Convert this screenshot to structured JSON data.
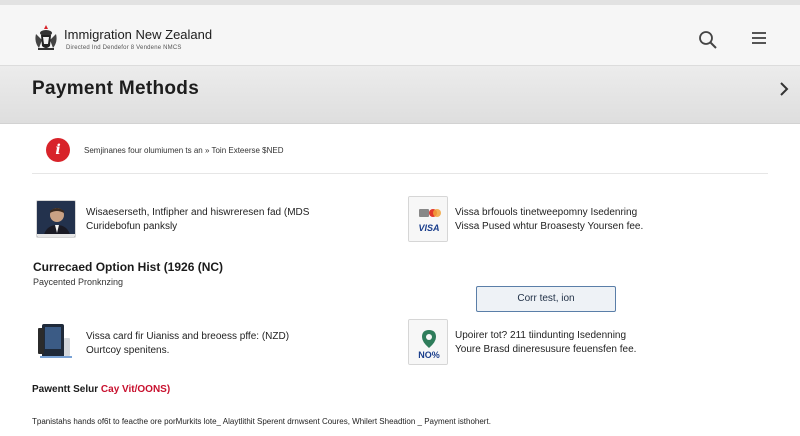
{
  "header": {
    "brand": "Immigration New Zealand",
    "brand_sub": "Directed Ind Dendefor 8 Vendene NMCS",
    "icons": {
      "logo": "nz-coat-of-arms-icon",
      "search": "search-icon",
      "menu": "hamburger-menu-icon"
    }
  },
  "hero": {
    "title": "Payment Methods",
    "next_icon": "chevron-right-icon"
  },
  "notice": {
    "icon": "info-alert-icon",
    "text": "Semjinanes four olumiumen ts an » Toin Exteerse $NED"
  },
  "methods_top": [
    {
      "icon": "person-photo-icon",
      "line1": "Wisaeserseth, Intfipher and hiswreresen fad (MDS",
      "line2": "Curidebofun panksly"
    },
    {
      "icon": "visa-card-icon",
      "line1": "Vissa brfouols tinetweepomny Isedenring",
      "line2": "Vissa Pused whtur Broasesty Yoursen fee."
    }
  ],
  "section": {
    "title": "Currecaed Option Hist (1926 (NC)",
    "subtitle": "Paycented Pronknzing"
  },
  "action_button": {
    "label": "Corr test, ion"
  },
  "methods_bottom": [
    {
      "icon": "payment-terminal-icon",
      "line1": "Vissa card fir Uianiss and breoess pffe: (NZD)",
      "line2": "Ourtcoy spenitens."
    },
    {
      "icon": "location-pin-card-icon",
      "badge": "NO%",
      "line1": "Upoirer tot? 211 tiindunting Isedenning",
      "line2": "Youre Brasd dineresusure feuensfen fee."
    }
  ],
  "bottom_heading": {
    "prefix": "Pawentt Selur ",
    "red": "Cay Vit/OONS)"
  },
  "footer": {
    "text": "Tpanistahs hands of6t to feacthe ore porMurkits lote_ Alaytlithit Sperent drnwsent Coures, Whilert Sheadtion _ Payment isthohert."
  },
  "colors": {
    "accent_red": "#d8232a",
    "button_border": "#5a7ea8",
    "visa_blue": "#1a3e8c"
  }
}
